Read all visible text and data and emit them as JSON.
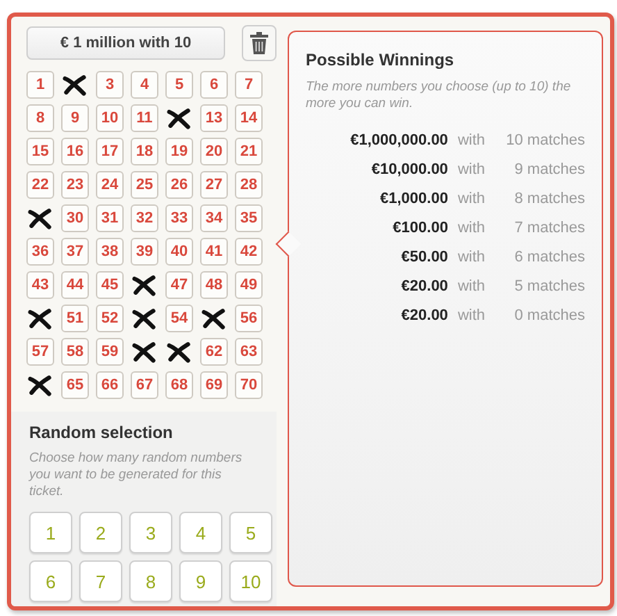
{
  "jackpot_button": "€ 1 million with 10",
  "numbers": [
    {
      "label": "1",
      "selected": false
    },
    {
      "selected": true
    },
    {
      "label": "3",
      "selected": false
    },
    {
      "label": "4",
      "selected": false
    },
    {
      "label": "5",
      "selected": false
    },
    {
      "label": "6",
      "selected": false
    },
    {
      "label": "7",
      "selected": false
    },
    {
      "label": "8",
      "selected": false
    },
    {
      "label": "9",
      "selected": false
    },
    {
      "label": "10",
      "selected": false
    },
    {
      "label": "11",
      "selected": false
    },
    {
      "selected": true
    },
    {
      "label": "13",
      "selected": false
    },
    {
      "label": "14",
      "selected": false
    },
    {
      "label": "15",
      "selected": false
    },
    {
      "label": "16",
      "selected": false
    },
    {
      "label": "17",
      "selected": false
    },
    {
      "label": "18",
      "selected": false
    },
    {
      "label": "19",
      "selected": false
    },
    {
      "label": "20",
      "selected": false
    },
    {
      "label": "21",
      "selected": false
    },
    {
      "label": "22",
      "selected": false
    },
    {
      "label": "23",
      "selected": false
    },
    {
      "label": "24",
      "selected": false
    },
    {
      "label": "25",
      "selected": false
    },
    {
      "label": "26",
      "selected": false
    },
    {
      "label": "27",
      "selected": false
    },
    {
      "label": "28",
      "selected": false
    },
    {
      "selected": true
    },
    {
      "label": "30",
      "selected": false
    },
    {
      "label": "31",
      "selected": false
    },
    {
      "label": "32",
      "selected": false
    },
    {
      "label": "33",
      "selected": false
    },
    {
      "label": "34",
      "selected": false
    },
    {
      "label": "35",
      "selected": false
    },
    {
      "label": "36",
      "selected": false
    },
    {
      "label": "37",
      "selected": false
    },
    {
      "label": "38",
      "selected": false
    },
    {
      "label": "39",
      "selected": false
    },
    {
      "label": "40",
      "selected": false
    },
    {
      "label": "41",
      "selected": false
    },
    {
      "label": "42",
      "selected": false
    },
    {
      "label": "43",
      "selected": false
    },
    {
      "label": "44",
      "selected": false
    },
    {
      "label": "45",
      "selected": false
    },
    {
      "selected": true
    },
    {
      "label": "47",
      "selected": false
    },
    {
      "label": "48",
      "selected": false
    },
    {
      "label": "49",
      "selected": false
    },
    {
      "selected": true
    },
    {
      "label": "51",
      "selected": false
    },
    {
      "label": "52",
      "selected": false
    },
    {
      "selected": true
    },
    {
      "label": "54",
      "selected": false
    },
    {
      "selected": true
    },
    {
      "label": "56",
      "selected": false
    },
    {
      "label": "57",
      "selected": false
    },
    {
      "label": "58",
      "selected": false
    },
    {
      "label": "59",
      "selected": false
    },
    {
      "selected": true
    },
    {
      "selected": true
    },
    {
      "label": "62",
      "selected": false
    },
    {
      "label": "63",
      "selected": false
    },
    {
      "selected": true
    },
    {
      "label": "65",
      "selected": false
    },
    {
      "label": "66",
      "selected": false
    },
    {
      "label": "67",
      "selected": false
    },
    {
      "label": "68",
      "selected": false
    },
    {
      "label": "69",
      "selected": false
    },
    {
      "label": "70",
      "selected": false
    }
  ],
  "random_selection": {
    "title": "Random selection",
    "description": "Choose how many random numbers you want to be generated for this ticket.",
    "buttons": [
      "1",
      "2",
      "3",
      "4",
      "5",
      "6",
      "7",
      "8",
      "9",
      "10"
    ]
  },
  "winnings": {
    "title": "Possible Winnings",
    "description": "The more numbers you choose (up to 10) the more you can win.",
    "rows": [
      {
        "amount": "€1,000,000.00",
        "with": "with",
        "matches": "10 matches"
      },
      {
        "amount": "€10,000.00",
        "with": "with",
        "matches": "9 matches"
      },
      {
        "amount": "€1,000.00",
        "with": "with",
        "matches": "8 matches"
      },
      {
        "amount": "€100.00",
        "with": "with",
        "matches": "7 matches"
      },
      {
        "amount": "€50.00",
        "with": "with",
        "matches": "6 matches"
      },
      {
        "amount": "€20.00",
        "with": "with",
        "matches": "5 matches"
      },
      {
        "amount": "€20.00",
        "with": "with",
        "matches": "0 matches"
      }
    ]
  }
}
